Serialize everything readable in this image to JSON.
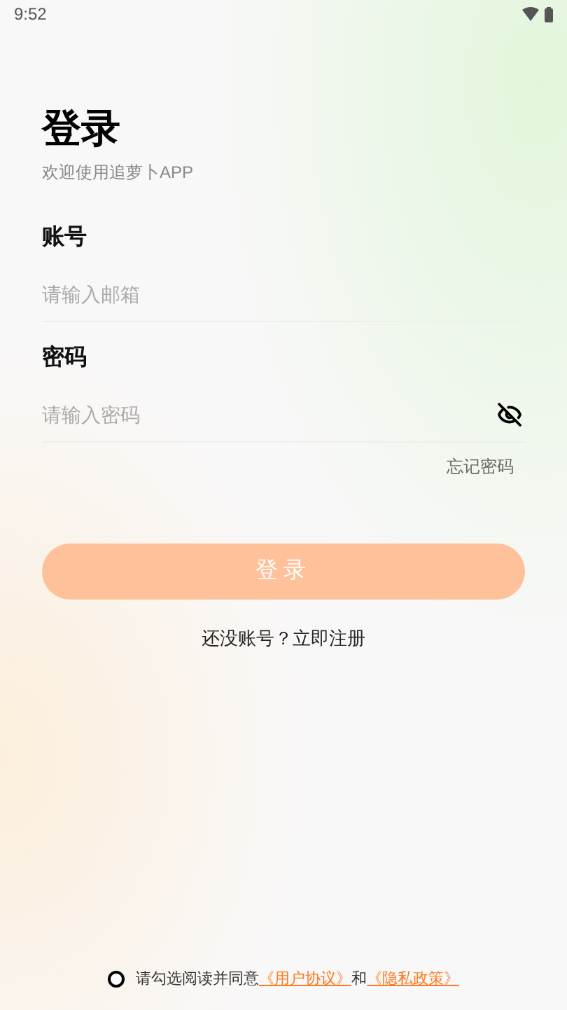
{
  "status_bar": {
    "time": "9:52"
  },
  "header": {
    "title": "登录",
    "subtitle": "欢迎使用追萝卜APP"
  },
  "fields": [
    {
      "label": "账号",
      "placeholder": "请输入邮箱",
      "kind": "text"
    },
    {
      "label": "密码",
      "placeholder": "请输入密码",
      "kind": "password",
      "visible": false
    }
  ],
  "forgot_link": "忘记密码",
  "login_button": {
    "label": "登录",
    "disabled": true
  },
  "register_link": "还没账号？立即注册",
  "agreement": {
    "checked": false,
    "text": "请勾选阅读并同意",
    "link_1": "《用户协议》",
    "joiner": "和",
    "link_2": "《隐私政策》"
  }
}
